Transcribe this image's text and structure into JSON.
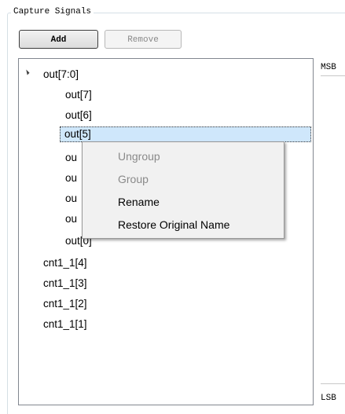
{
  "capture": {
    "title": "Capture Signals",
    "add_label": "Add",
    "remove_label": "Remove"
  },
  "tree": {
    "group_label": "out[7:0]",
    "children": [
      "out[7]",
      "out[6]",
      "out[5]",
      "ou",
      "ou",
      "ou",
      "ou",
      "out[0]"
    ],
    "others": [
      "cnt1_1[4]",
      "cnt1_1[3]",
      "cnt1_1[2]",
      "cnt1_1[1]"
    ],
    "selected": "out[5]"
  },
  "ruler": {
    "msb": "MSB",
    "lsb": "LSB"
  },
  "context_menu": {
    "items": [
      {
        "label": "Ungroup",
        "enabled": false
      },
      {
        "label": "Group",
        "enabled": false
      },
      {
        "label": "Rename",
        "enabled": true
      },
      {
        "label": "Restore Original Name",
        "enabled": true
      }
    ]
  }
}
